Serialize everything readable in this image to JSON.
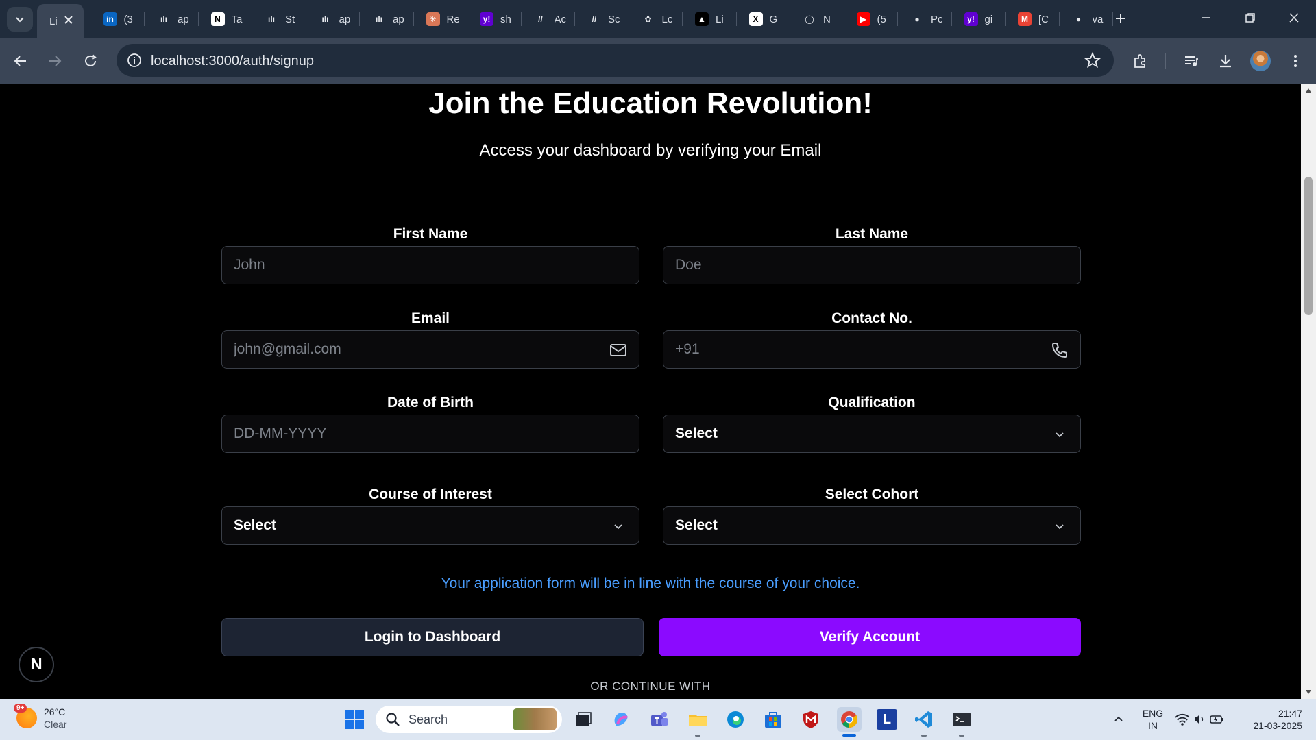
{
  "browser": {
    "tabs": [
      {
        "label": "Li",
        "favicon": "app",
        "color": "#3a4556",
        "active": true
      },
      {
        "label": "(3",
        "favicon": "linkedin-icon",
        "color": "#0a66c2"
      },
      {
        "label": "ap",
        "favicon": "bar-icon",
        "color": "#202c3c"
      },
      {
        "label": "Ta",
        "favicon": "notion-icon",
        "color": "#ffffff"
      },
      {
        "label": "St",
        "favicon": "bar-icon",
        "color": "#202c3c"
      },
      {
        "label": "ap",
        "favicon": "bar-icon",
        "color": "#202c3c"
      },
      {
        "label": "ap",
        "favicon": "bar-icon",
        "color": "#202c3c"
      },
      {
        "label": "Re",
        "favicon": "claude-icon",
        "color": "#d97757"
      },
      {
        "label": "sh",
        "favicon": "yahoo-icon",
        "color": "#6001d2"
      },
      {
        "label": "Ac",
        "favicon": "slash-icon",
        "color": "#202c3c"
      },
      {
        "label": "Sc",
        "favicon": "slash-icon",
        "color": "#202c3c"
      },
      {
        "label": "Lc",
        "favicon": "openai-icon",
        "color": "#202c3c"
      },
      {
        "label": "Li",
        "favicon": "triangle-icon",
        "color": "#000000"
      },
      {
        "label": "G",
        "favicon": "x-icon",
        "color": "#ffffff"
      },
      {
        "label": "N",
        "favicon": "circle-icon",
        "color": "#202c3c"
      },
      {
        "label": "(5",
        "favicon": "youtube-icon",
        "color": "#ff0000"
      },
      {
        "label": "Pc",
        "favicon": "github-icon",
        "color": "#202c3c"
      },
      {
        "label": "gi",
        "favicon": "yahoo-icon",
        "color": "#6001d2"
      },
      {
        "label": "[C",
        "favicon": "gmail-icon",
        "color": "#ea4335"
      },
      {
        "label": "va",
        "favicon": "github-icon",
        "color": "#202c3c"
      }
    ],
    "url": "localhost:3000/auth/signup"
  },
  "page": {
    "title": "Join the Education Revolution!",
    "subtitle": "Access your dashboard by verifying your Email",
    "fields": {
      "first_name": {
        "label": "First Name",
        "placeholder": "John"
      },
      "last_name": {
        "label": "Last Name",
        "placeholder": "Doe"
      },
      "email": {
        "label": "Email",
        "placeholder": "john@gmail.com"
      },
      "contact": {
        "label": "Contact No.",
        "placeholder": "+91"
      },
      "dob": {
        "label": "Date of Birth",
        "placeholder": "DD-MM-YYYY"
      },
      "qualification": {
        "label": "Qualification",
        "value": "Select"
      },
      "course": {
        "label": "Course of Interest",
        "value": "Select"
      },
      "cohort": {
        "label": "Select Cohort",
        "value": "Select"
      }
    },
    "note": "Your application form will be in line with the course of your choice.",
    "login_button": "Login to Dashboard",
    "verify_button": "Verify Account",
    "divider": "OR CONTINUE WITH",
    "next_badge": "N"
  },
  "taskbar": {
    "weather_temp": "26°C",
    "weather_desc": "Clear",
    "weather_badge": "9+",
    "search_placeholder": "Search",
    "lang_top": "ENG",
    "lang_bottom": "IN",
    "time": "21:47",
    "date": "21-03-2025"
  },
  "colors": {
    "accent_purple": "#8b0aff",
    "note_blue": "#4a9eff",
    "page_bg": "#000000"
  }
}
